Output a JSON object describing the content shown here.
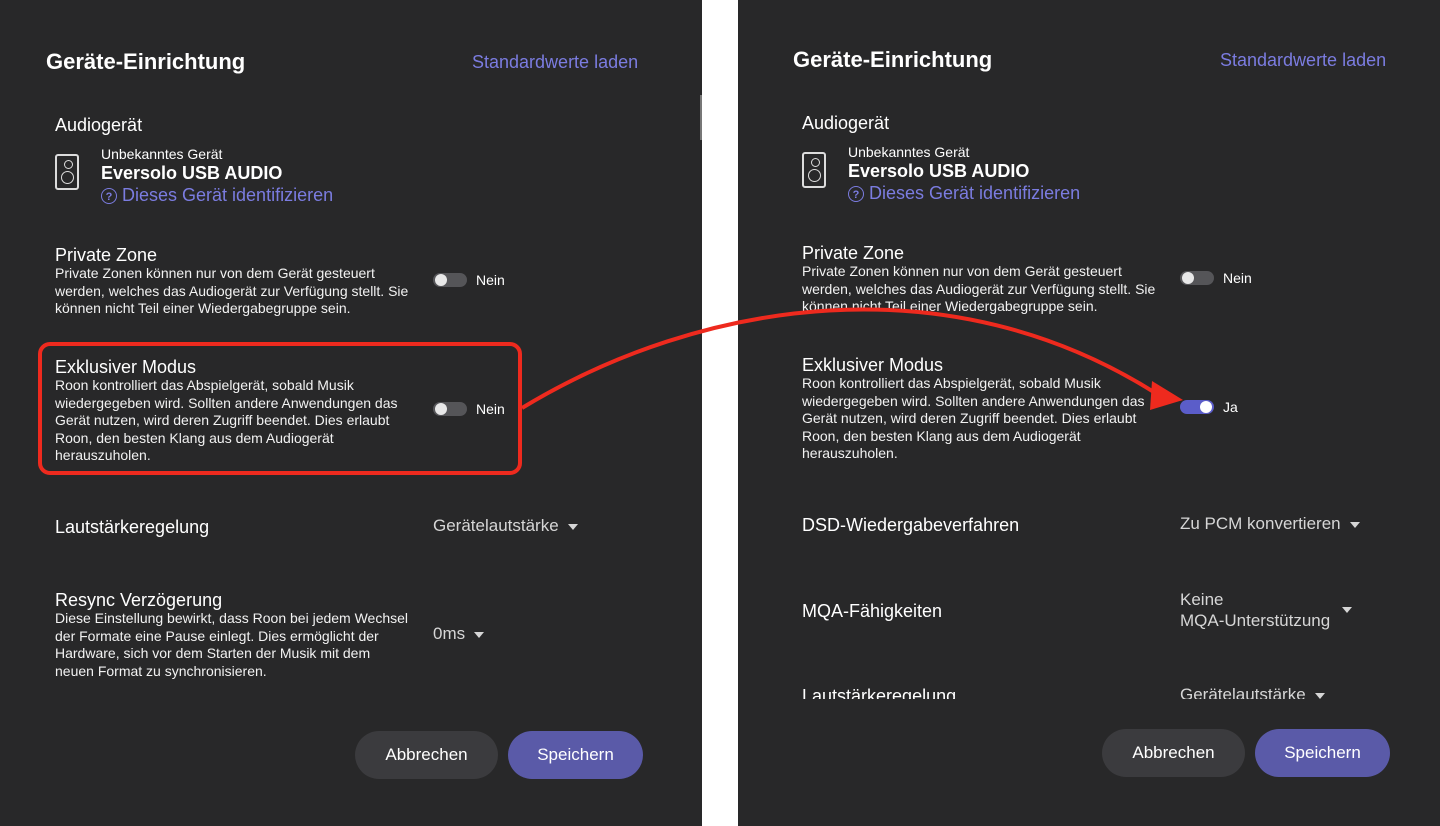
{
  "left": {
    "title": "Geräte-Einrichtung",
    "reset_link": "Standardwerte laden",
    "audio_device": {
      "section": "Audiogerät",
      "kind": "Unbekanntes Gerät",
      "name": "Eversolo USB AUDIO",
      "identify": "Dieses Gerät identifizieren",
      "icon": "speaker-icon"
    },
    "private_zone": {
      "title": "Private Zone",
      "lines": [
        "Private Zonen können nur von dem Gerät gesteuert",
        "werden, welches das Audiogerät zur Verfügung stellt. Sie",
        "können nicht Teil einer Wiedergabegruppe sein."
      ],
      "value": "Nein"
    },
    "exclusive": {
      "title": "Exklusiver Modus",
      "lines": [
        "Roon kontrolliert das Abspielgerät, sobald Musik",
        "wiedergegeben wird. Sollten andere Anwendungen das",
        "Gerät nutzen, wird deren Zugriff beendet. Dies erlaubt",
        "Roon, den besten Klang aus dem Audiogerät",
        "herauszuholen."
      ],
      "value": "Nein"
    },
    "volume": {
      "label": "Lautstärkeregelung",
      "value": "Gerätelautstärke"
    },
    "resync": {
      "title": "Resync Verzögerung",
      "lines": [
        "Diese Einstellung bewirkt, dass Roon bei jedem Wechsel",
        "der Formate eine Pause einlegt. Dies ermöglicht der",
        "Hardware, sich vor dem Starten der Musik mit dem",
        "neuen Format zu synchronisieren."
      ],
      "value": "0ms"
    },
    "cancel": "Abbrechen",
    "save": "Speichern"
  },
  "right": {
    "title": "Geräte-Einrichtung",
    "reset_link": "Standardwerte laden",
    "audio_device": {
      "section": "Audiogerät",
      "kind": "Unbekanntes Gerät",
      "name": "Eversolo USB AUDIO",
      "identify": "Dieses Gerät identifizieren",
      "icon": "speaker-icon"
    },
    "private_zone": {
      "title": "Private Zone",
      "lines": [
        "Private Zonen können nur von dem Gerät gesteuert",
        "werden, welches das Audiogerät zur Verfügung stellt. Sie",
        "können nicht Teil einer Wiedergabegruppe sein."
      ],
      "value": "Nein"
    },
    "exclusive": {
      "title": "Exklusiver Modus",
      "lines": [
        "Roon kontrolliert das Abspielgerät, sobald Musik",
        "wiedergegeben wird. Sollten andere Anwendungen das",
        "Gerät nutzen, wird deren Zugriff beendet. Dies erlaubt",
        "Roon, den besten Klang aus dem Audiogerät",
        "herauszuholen."
      ],
      "value": "Ja"
    },
    "dsd": {
      "label": "DSD-Wiedergabeverfahren",
      "value": "Zu PCM konvertieren"
    },
    "mqa": {
      "label": "MQA-Fähigkeiten",
      "value_line1": "Keine",
      "value_line2": "MQA-Unterstützung"
    },
    "volume": {
      "label": "Lautstärkeregelung",
      "value": "Gerätelautstärke"
    },
    "cancel": "Abbrechen",
    "save": "Speichern"
  },
  "colors": {
    "panel_bg": "#282829",
    "accent": "#7b7ce0",
    "highlight": "#ee2a1e",
    "toggle_on": "#5b5dc9",
    "save_button": "#5a5aa8"
  }
}
